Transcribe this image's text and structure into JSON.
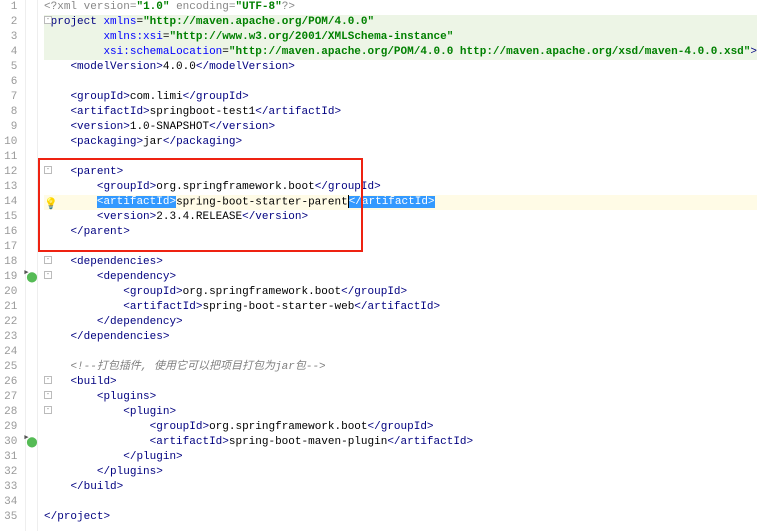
{
  "lines": {
    "l1": {
      "num": "1"
    },
    "l2": {
      "num": "2"
    },
    "l3": {
      "num": "3"
    },
    "l4": {
      "num": "4"
    },
    "l5": {
      "num": "5"
    },
    "l6": {
      "num": "6"
    },
    "l7": {
      "num": "7"
    },
    "l8": {
      "num": "8"
    },
    "l9": {
      "num": "9"
    },
    "l10": {
      "num": "10"
    },
    "l11": {
      "num": "11"
    },
    "l12": {
      "num": "12"
    },
    "l13": {
      "num": "13"
    },
    "l14": {
      "num": "14"
    },
    "l15": {
      "num": "15"
    },
    "l16": {
      "num": "16"
    },
    "l17": {
      "num": "17"
    },
    "l18": {
      "num": "18"
    },
    "l19": {
      "num": "19"
    },
    "l20": {
      "num": "20"
    },
    "l21": {
      "num": "21"
    },
    "l22": {
      "num": "22"
    },
    "l23": {
      "num": "23"
    },
    "l24": {
      "num": "24"
    },
    "l25": {
      "num": "25"
    },
    "l26": {
      "num": "26"
    },
    "l27": {
      "num": "27"
    },
    "l28": {
      "num": "28"
    },
    "l29": {
      "num": "29"
    },
    "l30": {
      "num": "30"
    },
    "l31": {
      "num": "31"
    },
    "l32": {
      "num": "32"
    },
    "l33": {
      "num": "33"
    },
    "l34": {
      "num": "34"
    },
    "l35": {
      "num": "35"
    }
  },
  "xml": {
    "decl_pre": "<?",
    "decl_name": "xml",
    "decl_ver_key": " version",
    "decl_ver_val": "\"1.0\"",
    "decl_enc_key": " encoding",
    "decl_enc_val": "\"UTF-8\"",
    "decl_close": "?>",
    "project_open": "<",
    "project": "project",
    "xmlns_key": " xmlns",
    "xmlns_val": "\"http://maven.apache.org/POM/4.0.0\"",
    "xmlns_xsi_key": "xmlns:xsi",
    "xmlns_xsi_val": "\"http://www.w3.org/2001/XMLSchema-instance\"",
    "schemaLoc_key": "xsi:schemaLocation",
    "schemaLoc_val": "\"http://maven.apache.org/POM/4.0.0 http://maven.apache.org/xsd/maven-4.0.0.xsd\"",
    "gt": ">",
    "modelVersion_o": "<modelVersion>",
    "modelVersion_v": "4.0.0",
    "modelVersion_c": "</modelVersion>",
    "groupId_o": "<groupId>",
    "groupId_c": "</groupId>",
    "groupId_top": "com.limi",
    "artifactId_o": "<artifactId>",
    "artifactId_c": "</artifactId>",
    "artifactId_top": "springboot-test1",
    "version_o": "<version>",
    "version_c": "</version>",
    "version_top": "1.0-SNAPSHOT",
    "packaging_o": "<packaging>",
    "packaging_v": "jar",
    "packaging_c": "</packaging>",
    "parent_o": "<parent>",
    "parent_c": "</parent>",
    "parent_groupId": "org.springframework.boot",
    "parent_artifactId": "spring-boot-starter-parent",
    "parent_version": "2.3.4.RELEASE",
    "dependencies_o": "<dependencies>",
    "dependencies_c": "</dependencies>",
    "dependency_o": "<dependency>",
    "dependency_c": "</dependency>",
    "dep_groupId": "org.springframework.boot",
    "dep_artifactId": "spring-boot-starter-web",
    "comment": "<!--打包插件, 使用它可以把项目打包为jar包-->",
    "build_o": "<build>",
    "build_c": "</build>",
    "plugins_o": "<plugins>",
    "plugins_c": "</plugins>",
    "plugin_o": "<plugin>",
    "plugin_c": "</plugin>",
    "plugin_groupId": "org.springframework.boot",
    "plugin_artifactId": "spring-boot-maven-plugin",
    "project_close": "</project>"
  }
}
